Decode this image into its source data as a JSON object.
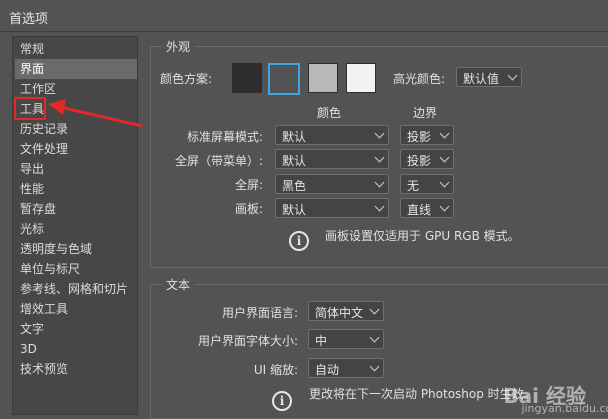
{
  "window": {
    "title": "首选项"
  },
  "sidebar": {
    "items": [
      {
        "label": "常规"
      },
      {
        "label": "界面"
      },
      {
        "label": "工作区"
      },
      {
        "label": "工具"
      },
      {
        "label": "历史记录"
      },
      {
        "label": "文件处理"
      },
      {
        "label": "导出"
      },
      {
        "label": "性能"
      },
      {
        "label": "暂存盘"
      },
      {
        "label": "光标"
      },
      {
        "label": "透明度与色域"
      },
      {
        "label": "单位与标尺"
      },
      {
        "label": "参考线、网格和切片"
      },
      {
        "label": "增效工具"
      },
      {
        "label": "文字"
      },
      {
        "label": "3D"
      },
      {
        "label": "技术预览"
      }
    ],
    "selected": "界面",
    "highlighted": "工具",
    "highlight_color": "#e32828"
  },
  "appearance": {
    "title": "外观",
    "color_scheme_label": "颜色方案:",
    "swatches": [
      {
        "color": "#2e2e2e",
        "selected": false
      },
      {
        "color": "#535353",
        "selected": true
      },
      {
        "color": "#b8b8b8",
        "selected": false
      },
      {
        "color": "#f2f2f2",
        "selected": false
      }
    ],
    "highlight_label": "高光颜色:",
    "highlight_value": "默认值",
    "col_color": "颜色",
    "col_border": "边界",
    "rows": [
      {
        "label": "标准屏幕模式:",
        "color": "默认",
        "border": "投影"
      },
      {
        "label": "全屏（带菜单）:",
        "color": "默认",
        "border": "投影"
      },
      {
        "label": "全屏:",
        "color": "黑色",
        "border": "无"
      },
      {
        "label": "画板:",
        "color": "默认",
        "border": "直线"
      }
    ],
    "note": "画板设置仅适用于 GPU RGB 模式。"
  },
  "text": {
    "title": "文本",
    "rows": [
      {
        "label": "用户界面语言:",
        "value": "简体中文"
      },
      {
        "label": "用户界面字体大小:",
        "value": "中"
      },
      {
        "label": "UI 缩放:",
        "value": "自动"
      }
    ],
    "note": "更改将在下一次启动 Photoshop 时生效。"
  },
  "watermark": {
    "text": "Bai 经验",
    "sub": "jingyan.baidu.com"
  },
  "accent": "#3ca4e8"
}
